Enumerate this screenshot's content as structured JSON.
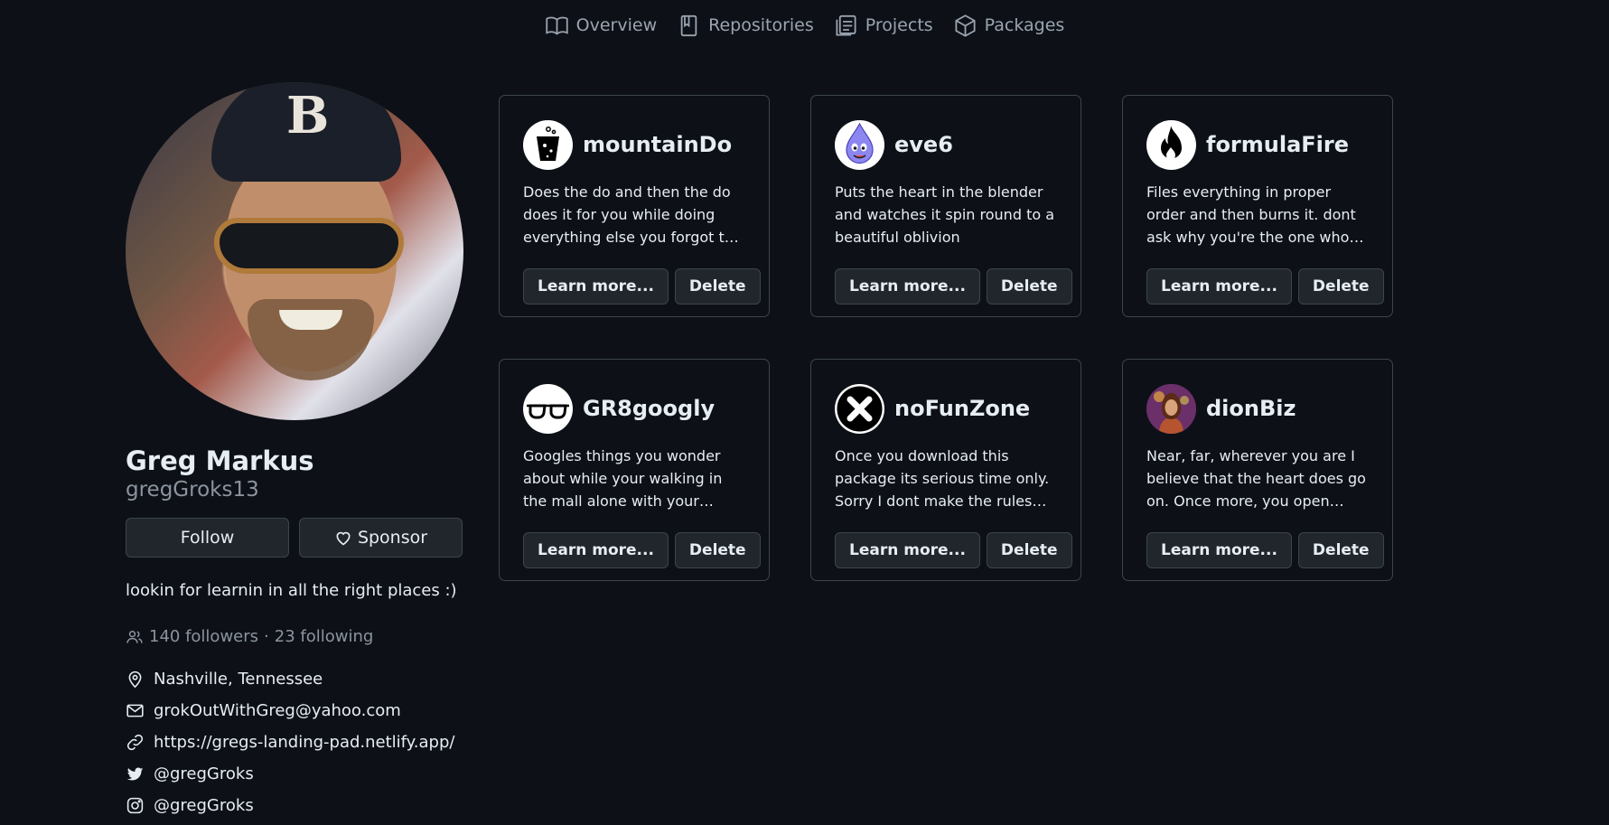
{
  "nav": {
    "items": [
      {
        "label": "Overview",
        "icon": "book-icon"
      },
      {
        "label": "Repositories",
        "icon": "repo-icon"
      },
      {
        "label": "Projects",
        "icon": "project-icon"
      },
      {
        "label": "Packages",
        "icon": "package-icon"
      }
    ]
  },
  "profile": {
    "name": "Greg Markus",
    "login": "gregGroks13",
    "follow_label": "Follow",
    "sponsor_label": "Sponsor",
    "bio": "lookin for learnin in all the right places :)",
    "followers": "140 followers",
    "separator": "·",
    "following": "23 following",
    "location": "Nashville, Tennessee",
    "email": "grokOutWithGreg@yahoo.com",
    "website": "https://gregs-landing-pad.netlify.app/",
    "twitter": "@gregGroks",
    "instagram": "@gregGroks"
  },
  "packages": [
    {
      "name": "mountainDo",
      "icon": "cup-icon",
      "description": "Does the do and then the do does it for you while doing everything else you forgot to do",
      "learn_label": "Learn more...",
      "delete_label": "Delete"
    },
    {
      "name": "eve6",
      "icon": "droplet-character-icon",
      "description": "Puts the heart in the blender and watches it spin round to a beautiful oblivion",
      "learn_label": "Learn more...",
      "delete_label": "Delete"
    },
    {
      "name": "formulaFire",
      "icon": "fire-icon",
      "description": "Files everything in proper order and then burns it. dont ask why you're the one who downloade...",
      "learn_label": "Learn more...",
      "delete_label": "Delete"
    },
    {
      "name": "GR8googly",
      "icon": "glasses-icon",
      "description": "Googles things you wonder about while your walking in the mall alone with your headphon...",
      "learn_label": "Learn more...",
      "delete_label": "Delete"
    },
    {
      "name": "noFunZone",
      "icon": "x-icon",
      "description": "Once you download this package its serious time only. Sorry I dont make the rules and you're the...",
      "learn_label": "Learn more...",
      "delete_label": "Delete"
    },
    {
      "name": "dionBiz",
      "icon": "singer-avatar-icon",
      "description": "Near, far, wherever you are I believe that the heart does go on. Once more, you open the...",
      "learn_label": "Learn more...",
      "delete_label": "Delete"
    }
  ]
}
